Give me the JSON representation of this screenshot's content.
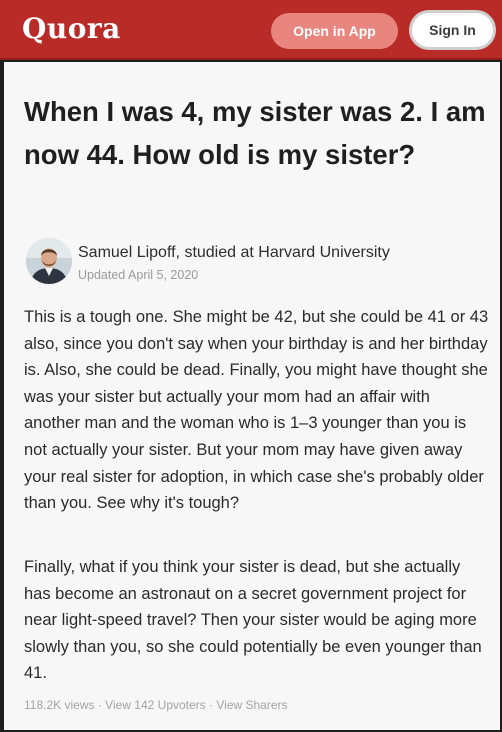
{
  "header": {
    "logo": "Quora",
    "open_in_app": "Open in App",
    "sign_in": "Sign In"
  },
  "question": {
    "title": "When I was 4, my sister was 2. I am now 44. How old is my sister?"
  },
  "answer": {
    "author": "Samuel Lipoff, studied at Harvard University",
    "updated": "Updated April 5, 2020",
    "paragraphs": [
      "This is a tough one. She might be 42, but she could be 41 or 43 also, since you don't say when your birthday is and her birthday is. Also, she could be dead. Finally, you might have thought she was your sister but actually your mom had an affair with another man and the woman who is 1–3 younger than you is not actually your sister. But your mom may have given away your real sister for adoption, in which case she's probably older than you. See why it's tough?",
      "Finally, what if you think your sister is dead, but she actually has become an astronaut on a secret government project for near light-speed travel? Then your sister would be aging more slowly than you, so she could potentially be even younger than 41."
    ],
    "views": "118.2K views",
    "upvoters": "View 142 Upvoters",
    "sharers": "View Sharers"
  },
  "colors": {
    "brand": "#b92b27",
    "open_button": "#e8857f"
  }
}
